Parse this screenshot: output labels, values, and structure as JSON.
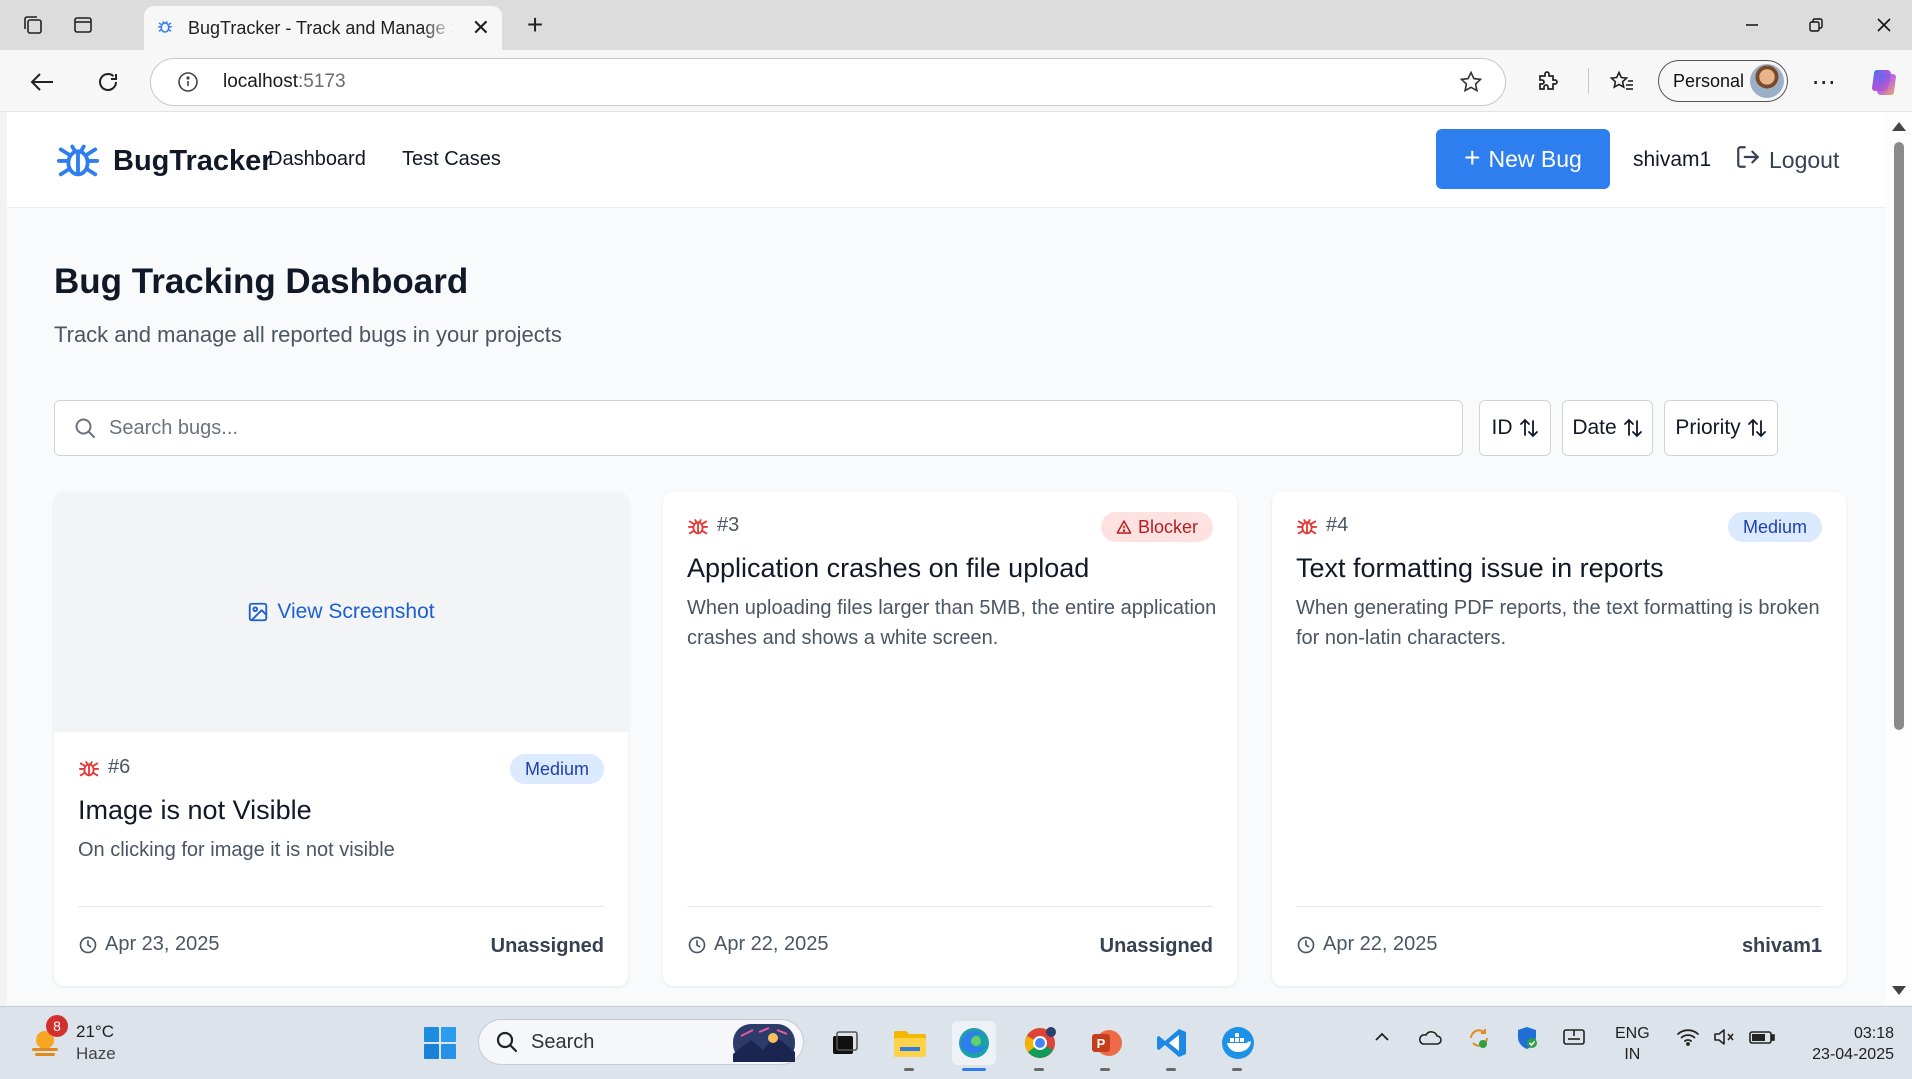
{
  "browser": {
    "tab_title": "BugTracker - Track and Manage Software Bugs",
    "url_host": "localhost",
    "url_port": ":5173",
    "profile_label": "Personal"
  },
  "app": {
    "brand": "BugTracker",
    "nav": [
      "Dashboard",
      "Test Cases"
    ],
    "new_bug_label": "New Bug",
    "username": "shivam1",
    "logout_label": "Logout"
  },
  "dashboard": {
    "title": "Bug Tracking Dashboard",
    "subtitle": "Track and manage all reported bugs in your projects",
    "search_placeholder": "Search bugs...",
    "sort_buttons": [
      "ID",
      "Date",
      "Priority"
    ]
  },
  "bugs": [
    {
      "id": "#6",
      "screenshot_label": "View Screenshot",
      "priority": "Medium",
      "title": "Image is not Visible",
      "description": "On clicking for image it is not visible",
      "date": "Apr 23, 2025",
      "assignee": "Unassigned"
    },
    {
      "id": "#3",
      "priority": "Blocker",
      "title": "Application crashes on file upload",
      "description": "When uploading files larger than 5MB, the entire application crashes and shows a white screen.",
      "date": "Apr 22, 2025",
      "assignee": "Unassigned"
    },
    {
      "id": "#4",
      "priority": "Medium",
      "title": "Text formatting issue in reports",
      "description": "When generating PDF reports, the text formatting is broken for non-latin characters.",
      "date": "Apr 22, 2025",
      "assignee": "shivam1"
    }
  ],
  "taskbar": {
    "weather_badge": "8",
    "temperature": "21°C",
    "condition": "Haze",
    "search_label": "Search",
    "lang_line1": "ENG",
    "lang_line2": "IN",
    "time": "03:18",
    "date": "23-04-2025"
  },
  "colors": {
    "primary": "#2f7ef0",
    "bug_icon": "#e53935",
    "medium_badge_bg": "#dbeafe",
    "blocker_badge_bg": "#fee2e2"
  }
}
